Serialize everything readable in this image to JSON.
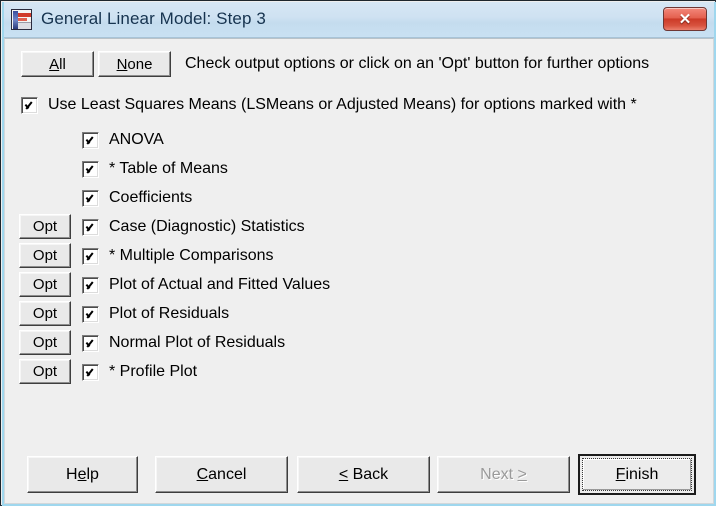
{
  "window": {
    "title": "General Linear Model: Step 3",
    "icon": "app-chart-icon",
    "close_label": "✕",
    "titlebar_color": "#cfe2f2",
    "frame_color": "#9fd7ee",
    "client_color": "#efefef"
  },
  "toolbar": {
    "all_label": "All",
    "all_mnemonic": "A",
    "none_label": "None",
    "none_mnemonic": "N",
    "hint": "Check output options or click on an 'Opt' button for further options"
  },
  "lsmeans": {
    "label": "Use Least Squares Means (LSMeans or Adjusted Means) for options marked with *",
    "checked": true
  },
  "options": [
    {
      "opt_button": false,
      "opt_label": "",
      "checked": true,
      "label": "ANOVA"
    },
    {
      "opt_button": false,
      "opt_label": "",
      "checked": true,
      "label": "* Table of Means"
    },
    {
      "opt_button": false,
      "opt_label": "",
      "checked": true,
      "label": "Coefficients"
    },
    {
      "opt_button": true,
      "opt_label": "Opt",
      "checked": true,
      "label": "Case (Diagnostic) Statistics"
    },
    {
      "opt_button": true,
      "opt_label": "Opt",
      "checked": true,
      "label": "* Multiple Comparisons"
    },
    {
      "opt_button": true,
      "opt_label": "Opt",
      "checked": true,
      "label": "Plot of Actual and Fitted Values"
    },
    {
      "opt_button": true,
      "opt_label": "Opt",
      "checked": true,
      "label": "Plot of Residuals"
    },
    {
      "opt_button": true,
      "opt_label": "Opt",
      "checked": true,
      "label": "Normal Plot of Residuals"
    },
    {
      "opt_button": true,
      "opt_label": "Opt",
      "checked": true,
      "label": "* Profile Plot"
    }
  ],
  "footer": {
    "help_pre": "H",
    "help_mn": "e",
    "help_post": "lp",
    "cancel_pre": "",
    "cancel_mn": "C",
    "cancel_post": "ancel",
    "back_pre": "",
    "back_mn": "<",
    "back_post": " Back",
    "next_pre": "Next ",
    "next_mn": ">",
    "next_post": "",
    "next_enabled": false,
    "finish_pre": "",
    "finish_mn": "F",
    "finish_post": "inish",
    "finish_default": true
  }
}
